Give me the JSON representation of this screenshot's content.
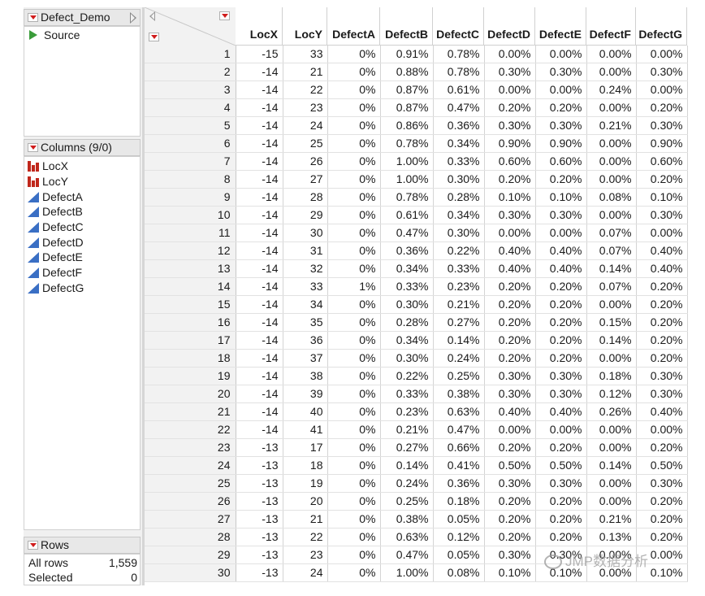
{
  "table_panel": {
    "name": "Defect_Demo",
    "source_label": "Source"
  },
  "columns_panel": {
    "title": "Columns (9/0)",
    "columns": [
      {
        "name": "LocX",
        "type": "nominal"
      },
      {
        "name": "LocY",
        "type": "nominal"
      },
      {
        "name": "DefectA",
        "type": "continuous"
      },
      {
        "name": "DefectB",
        "type": "continuous"
      },
      {
        "name": "DefectC",
        "type": "continuous"
      },
      {
        "name": "DefectD",
        "type": "continuous"
      },
      {
        "name": "DefectE",
        "type": "continuous"
      },
      {
        "name": "DefectF",
        "type": "continuous"
      },
      {
        "name": "DefectG",
        "type": "continuous"
      }
    ]
  },
  "rows_panel": {
    "title": "Rows",
    "all_rows_label": "All rows",
    "all_rows_value": "1,559",
    "selected_label": "Selected",
    "selected_value": "0"
  },
  "grid": {
    "headers": [
      "LocX",
      "LocY",
      "DefectA",
      "DefectB",
      "DefectC",
      "DefectD",
      "DefectE",
      "DefectF",
      "DefectG"
    ],
    "rows": [
      [
        "1",
        "-15",
        "33",
        "0%",
        "0.91%",
        "0.78%",
        "0.00%",
        "0.00%",
        "0.00%",
        "0.00%"
      ],
      [
        "2",
        "-14",
        "21",
        "0%",
        "0.88%",
        "0.78%",
        "0.30%",
        "0.30%",
        "0.00%",
        "0.30%"
      ],
      [
        "3",
        "-14",
        "22",
        "0%",
        "0.87%",
        "0.61%",
        "0.00%",
        "0.00%",
        "0.24%",
        "0.00%"
      ],
      [
        "4",
        "-14",
        "23",
        "0%",
        "0.87%",
        "0.47%",
        "0.20%",
        "0.20%",
        "0.00%",
        "0.20%"
      ],
      [
        "5",
        "-14",
        "24",
        "0%",
        "0.86%",
        "0.36%",
        "0.30%",
        "0.30%",
        "0.21%",
        "0.30%"
      ],
      [
        "6",
        "-14",
        "25",
        "0%",
        "0.78%",
        "0.34%",
        "0.90%",
        "0.90%",
        "0.00%",
        "0.90%"
      ],
      [
        "7",
        "-14",
        "26",
        "0%",
        "1.00%",
        "0.33%",
        "0.60%",
        "0.60%",
        "0.00%",
        "0.60%"
      ],
      [
        "8",
        "-14",
        "27",
        "0%",
        "1.00%",
        "0.30%",
        "0.20%",
        "0.20%",
        "0.00%",
        "0.20%"
      ],
      [
        "9",
        "-14",
        "28",
        "0%",
        "0.78%",
        "0.28%",
        "0.10%",
        "0.10%",
        "0.08%",
        "0.10%"
      ],
      [
        "10",
        "-14",
        "29",
        "0%",
        "0.61%",
        "0.34%",
        "0.30%",
        "0.30%",
        "0.00%",
        "0.30%"
      ],
      [
        "11",
        "-14",
        "30",
        "0%",
        "0.47%",
        "0.30%",
        "0.00%",
        "0.00%",
        "0.07%",
        "0.00%"
      ],
      [
        "12",
        "-14",
        "31",
        "0%",
        "0.36%",
        "0.22%",
        "0.40%",
        "0.40%",
        "0.07%",
        "0.40%"
      ],
      [
        "13",
        "-14",
        "32",
        "0%",
        "0.34%",
        "0.33%",
        "0.40%",
        "0.40%",
        "0.14%",
        "0.40%"
      ],
      [
        "14",
        "-14",
        "33",
        "1%",
        "0.33%",
        "0.23%",
        "0.20%",
        "0.20%",
        "0.07%",
        "0.20%"
      ],
      [
        "15",
        "-14",
        "34",
        "0%",
        "0.30%",
        "0.21%",
        "0.20%",
        "0.20%",
        "0.00%",
        "0.20%"
      ],
      [
        "16",
        "-14",
        "35",
        "0%",
        "0.28%",
        "0.27%",
        "0.20%",
        "0.20%",
        "0.15%",
        "0.20%"
      ],
      [
        "17",
        "-14",
        "36",
        "0%",
        "0.34%",
        "0.14%",
        "0.20%",
        "0.20%",
        "0.14%",
        "0.20%"
      ],
      [
        "18",
        "-14",
        "37",
        "0%",
        "0.30%",
        "0.24%",
        "0.20%",
        "0.20%",
        "0.00%",
        "0.20%"
      ],
      [
        "19",
        "-14",
        "38",
        "0%",
        "0.22%",
        "0.25%",
        "0.30%",
        "0.30%",
        "0.18%",
        "0.30%"
      ],
      [
        "20",
        "-14",
        "39",
        "0%",
        "0.33%",
        "0.38%",
        "0.30%",
        "0.30%",
        "0.12%",
        "0.30%"
      ],
      [
        "21",
        "-14",
        "40",
        "0%",
        "0.23%",
        "0.63%",
        "0.40%",
        "0.40%",
        "0.26%",
        "0.40%"
      ],
      [
        "22",
        "-14",
        "41",
        "0%",
        "0.21%",
        "0.47%",
        "0.00%",
        "0.00%",
        "0.00%",
        "0.00%"
      ],
      [
        "23",
        "-13",
        "17",
        "0%",
        "0.27%",
        "0.66%",
        "0.20%",
        "0.20%",
        "0.00%",
        "0.20%"
      ],
      [
        "24",
        "-13",
        "18",
        "0%",
        "0.14%",
        "0.41%",
        "0.50%",
        "0.50%",
        "0.14%",
        "0.50%"
      ],
      [
        "25",
        "-13",
        "19",
        "0%",
        "0.24%",
        "0.36%",
        "0.30%",
        "0.30%",
        "0.00%",
        "0.30%"
      ],
      [
        "26",
        "-13",
        "20",
        "0%",
        "0.25%",
        "0.18%",
        "0.20%",
        "0.20%",
        "0.00%",
        "0.20%"
      ],
      [
        "27",
        "-13",
        "21",
        "0%",
        "0.38%",
        "0.05%",
        "0.20%",
        "0.20%",
        "0.21%",
        "0.20%"
      ],
      [
        "28",
        "-13",
        "22",
        "0%",
        "0.63%",
        "0.12%",
        "0.20%",
        "0.20%",
        "0.13%",
        "0.20%"
      ],
      [
        "29",
        "-13",
        "23",
        "0%",
        "0.47%",
        "0.05%",
        "0.30%",
        "0.30%",
        "0.00%",
        "0.00%"
      ],
      [
        "30",
        "-13",
        "24",
        "0%",
        "1.00%",
        "0.08%",
        "0.10%",
        "0.10%",
        "0.00%",
        "0.10%"
      ]
    ]
  },
  "watermark": "JMP数据分析",
  "colors": {
    "nominal_icon": "#c0281c",
    "continuous_icon": "#3a6fc4",
    "source_icon": "#3a9c3a",
    "menu_triangle": "#d01c1c"
  }
}
